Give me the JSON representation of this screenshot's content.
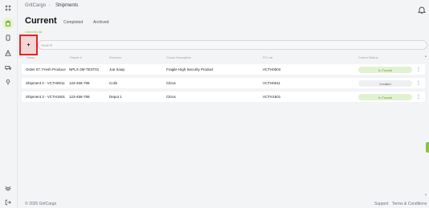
{
  "breadcrumb": {
    "home": "GritCargo",
    "separator": "›",
    "current": "Shipments"
  },
  "page": {
    "title": "Current",
    "subtitle": "shipments list"
  },
  "tabs": [
    "Completed",
    "Archived"
  ],
  "add_button": {
    "label": "+"
  },
  "search": {
    "placeholder": "Search"
  },
  "table": {
    "columns": [
      "Name",
      "Report #",
      "Receiver",
      "Goods Description",
      "PO List",
      "Current Status"
    ],
    "rows": [
      {
        "name": "Order 07: Fresh Produce",
        "report": "NPLX-JM-TEST01",
        "receiver": "Joe Soap",
        "goods": "Fragile High Security Product",
        "po": "VCTH0004",
        "status": "In Transit",
        "status_kind": "transit"
      },
      {
        "name": "Shipment 2 - VCTH0011",
        "report": "123-456-789",
        "receiver": "Colin",
        "goods": "Citrus",
        "po": "VCTH0011",
        "status": "Created",
        "status_kind": "created"
      },
      {
        "name": "Shipment 3 - VCTH1501",
        "report": "123-456-789",
        "receiver": "Depot 1",
        "goods": "Citrus",
        "po": "VCTH1501",
        "status": "In Transit",
        "status_kind": "transit"
      }
    ]
  },
  "footer": {
    "copyright": "© 2025 GritCargo",
    "support": "Support",
    "terms": "Terms & Conditions"
  },
  "colors": {
    "accent": "#8bc34a",
    "highlight": "#e02424"
  },
  "icons": [
    "dashboard-icon",
    "shipments-icon",
    "devices-icon",
    "alerts-icon",
    "trucks-icon",
    "location-icon",
    "integrations-icon",
    "logout-icon",
    "bell-icon",
    "kebab-icon"
  ]
}
